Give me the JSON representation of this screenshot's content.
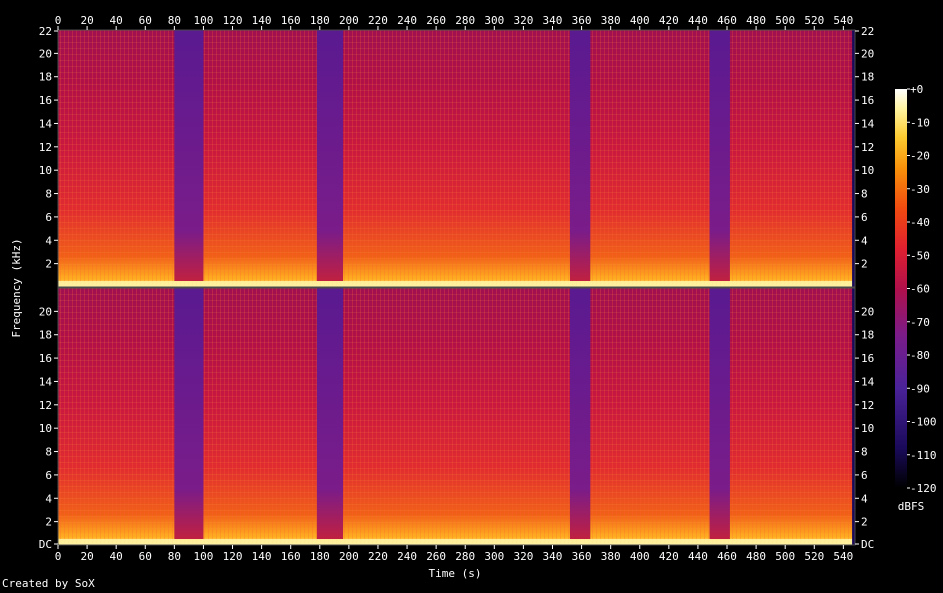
{
  "chart_data": {
    "type": "heatmap",
    "subtype": "spectrogram",
    "xlabel": "Time (s)",
    "ylabel": "Frequency (kHz)",
    "xlim": [
      0,
      548
    ],
    "ylim": [
      0,
      22
    ],
    "x_ticks": [
      "0",
      "20",
      "40",
      "60",
      "80",
      "100",
      "120",
      "140",
      "160",
      "180",
      "200",
      "220",
      "240",
      "260",
      "280",
      "300",
      "320",
      "340",
      "360",
      "380",
      "400",
      "420",
      "440",
      "460",
      "480",
      "500",
      "520",
      "540"
    ],
    "channels": [
      {
        "y_ticks": [
          "2",
          "4",
          "6",
          "8",
          "10",
          "12",
          "14",
          "16",
          "18",
          "20",
          "22"
        ]
      },
      {
        "y_ticks": [
          "DC",
          "2",
          "4",
          "6",
          "8",
          "10",
          "12",
          "14",
          "16",
          "18",
          "20"
        ]
      }
    ],
    "colorbar": {
      "label": "dBFS",
      "range": [
        -120,
        0
      ],
      "ticks": [
        "+0",
        "-10",
        "-20",
        "-30",
        "-40",
        "-50",
        "-60",
        "-70",
        "-80",
        "-90",
        "-100",
        "-110",
        "-120"
      ],
      "colors": [
        "#000000",
        "#1a0a5a",
        "#4a2299",
        "#7a1c8a",
        "#b0104a",
        "#e02030",
        "#f04a10",
        "#f8900a",
        "#fccb30",
        "#fff4a0",
        "#ffffff"
      ]
    },
    "quiet_segments_s": [
      [
        80,
        100
      ],
      [
        178,
        196
      ],
      [
        352,
        366
      ],
      [
        448,
        462
      ]
    ],
    "grid": false
  },
  "footer": {
    "credit": "Created by SoX"
  }
}
